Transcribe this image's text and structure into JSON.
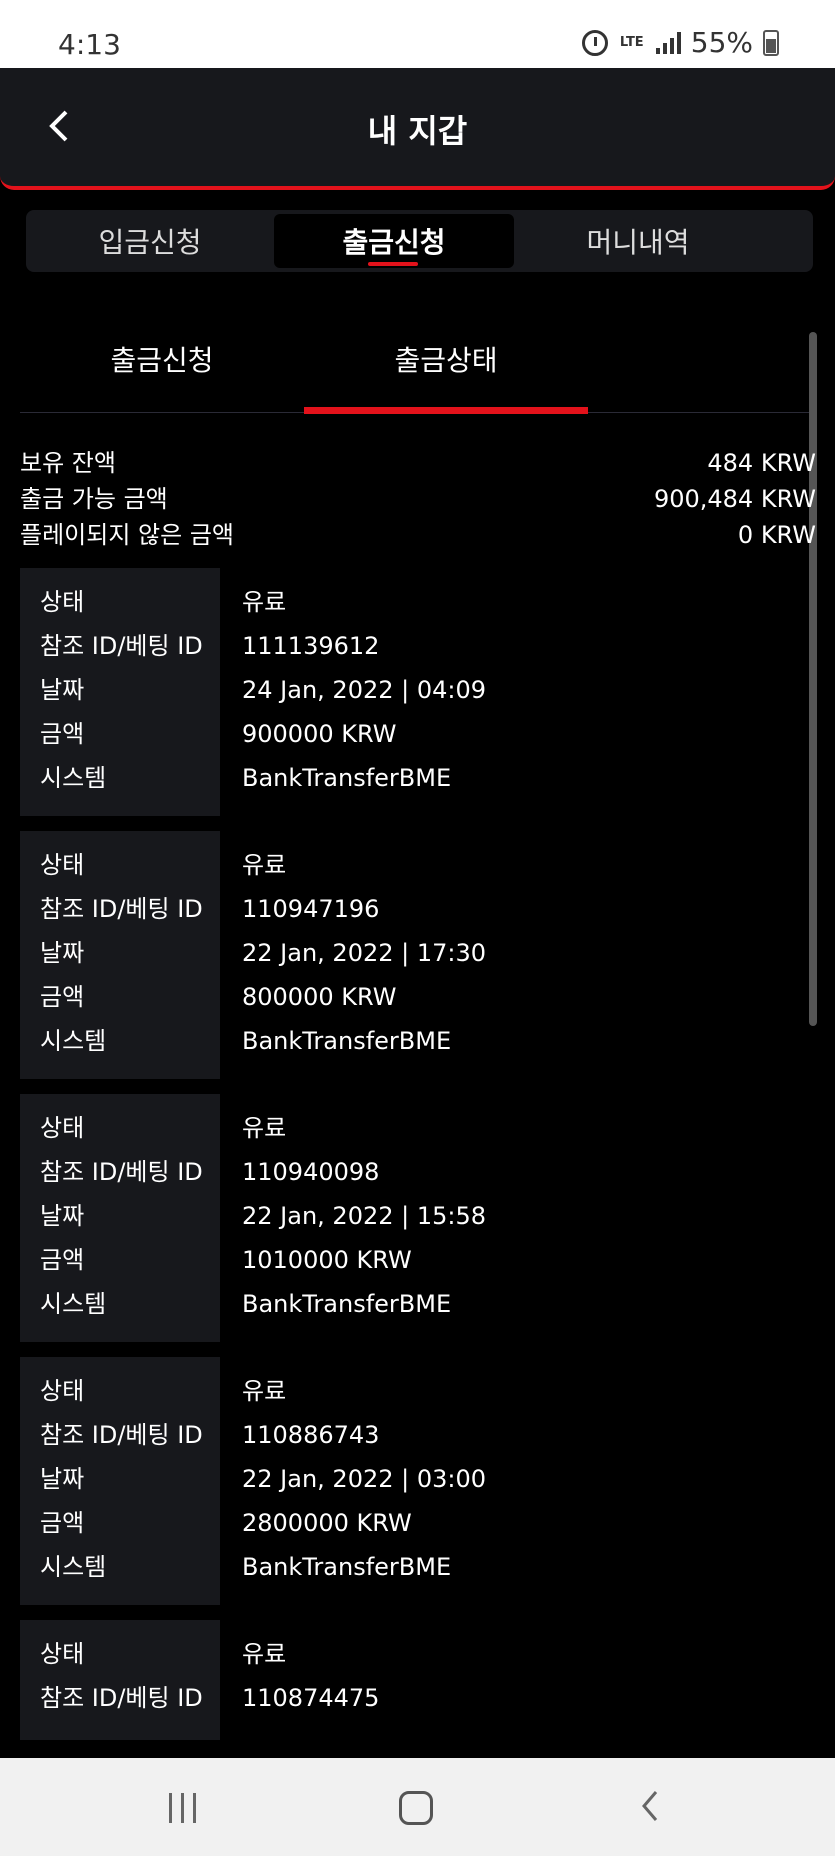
{
  "status_bar": {
    "time": "4:13",
    "network": "LTE",
    "battery": "55%"
  },
  "header": {
    "title": "내 지갑"
  },
  "main_tabs": [
    {
      "label": "입금신청",
      "active": false
    },
    {
      "label": "출금신청",
      "active": true
    },
    {
      "label": "머니내역",
      "active": false
    }
  ],
  "sub_tabs": [
    {
      "label": "출금신청",
      "active": false
    },
    {
      "label": "출금상태",
      "active": true
    }
  ],
  "summary": [
    {
      "label": "보유 잔액",
      "value": "484 KRW"
    },
    {
      "label": "출금 가능 금액",
      "value": "900,484 KRW"
    },
    {
      "label": "플레이되지 않은 금액",
      "value": "0 KRW"
    }
  ],
  "record_labels": {
    "status": "상태",
    "ref": "참조 ID/베팅 ID",
    "date": "날짜",
    "amount": "금액",
    "system": "시스템"
  },
  "records": [
    {
      "status": "유료",
      "ref": "111139612",
      "date": "24 Jan, 2022 | 04:09",
      "amount": "900000 KRW",
      "system": "BankTransferBME"
    },
    {
      "status": "유료",
      "ref": "110947196",
      "date": "22 Jan, 2022 | 17:30",
      "amount": "800000 KRW",
      "system": "BankTransferBME"
    },
    {
      "status": "유료",
      "ref": "110940098",
      "date": "22 Jan, 2022 | 15:58",
      "amount": "1010000 KRW",
      "system": "BankTransferBME"
    },
    {
      "status": "유료",
      "ref": "110886743",
      "date": "22 Jan, 2022 | 03:00",
      "amount": "2800000 KRW",
      "system": "BankTransferBME"
    },
    {
      "status": "유료",
      "ref": "110874475",
      "date": "",
      "amount": "",
      "system": ""
    }
  ],
  "colors": {
    "accent": "#e3121b",
    "panel": "#17181c",
    "background": "#000000"
  }
}
